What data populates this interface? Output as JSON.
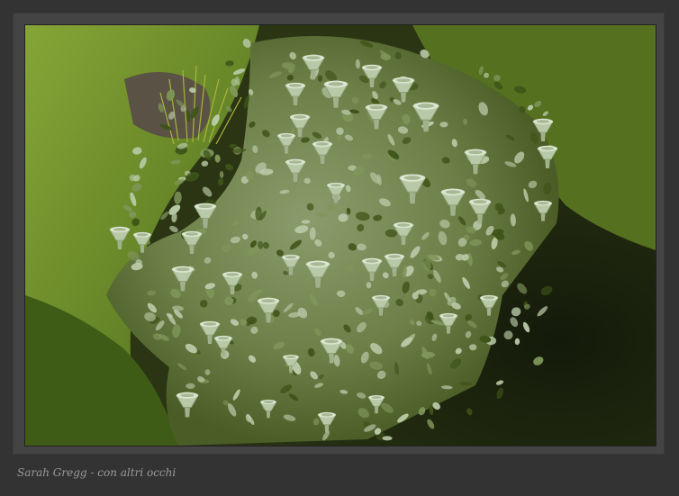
{
  "photo": {
    "subject": "cup lichen (Cladonia) podetia among foliose squamules and moss on rock",
    "palette": {
      "moss": "#6f8f2c",
      "moss_dark": "#3e5418",
      "lichen": "#b8c9a7",
      "lichen_highlight": "#dbe5cf",
      "shadow": "#1b2210",
      "rock": "#5a5244"
    }
  },
  "credit": {
    "text": "Sarah Gregg - con altri occhi"
  }
}
